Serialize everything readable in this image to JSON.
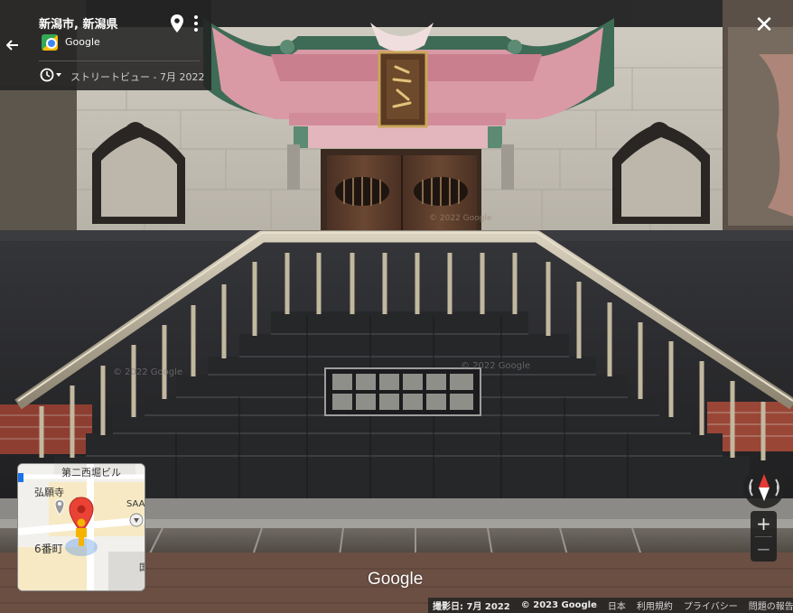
{
  "header": {
    "title": "新潟市, 新潟県",
    "provider": "Google",
    "imagery_label": "ストリートビュー - 7月 2022"
  },
  "scene_watermarks": [
    "© 2022 Google",
    "© 2022 Google",
    "© 2022 Google"
  ],
  "minimap": {
    "labels": {
      "building": "第二西堀ビル",
      "temple": "弘願寺",
      "saa": "SAA",
      "district": "6番町",
      "edge": "国"
    }
  },
  "zoom": {
    "in_label": "+",
    "out_label": "−"
  },
  "close_label": "✕",
  "watermark": "Google",
  "footer": {
    "capture_date": "撮影日: 7月 2022",
    "copyright": "© 2023 Google",
    "country": "日本",
    "terms": "利用規約",
    "privacy": "プライバシー",
    "report": "問題の報告"
  },
  "colors": {
    "panel": "#222222",
    "roof_pink": "#d99aa5",
    "roof_green": "#4e7a62",
    "wall": "#d4d1c7",
    "granite": "#2a2a2b",
    "door_wood": "#5b3c2a",
    "rail": "#b7ad98",
    "brick": "#9a4637",
    "map_pin": "#ea4335",
    "pegman": "#f5b400",
    "compass_red": "#e53935"
  }
}
